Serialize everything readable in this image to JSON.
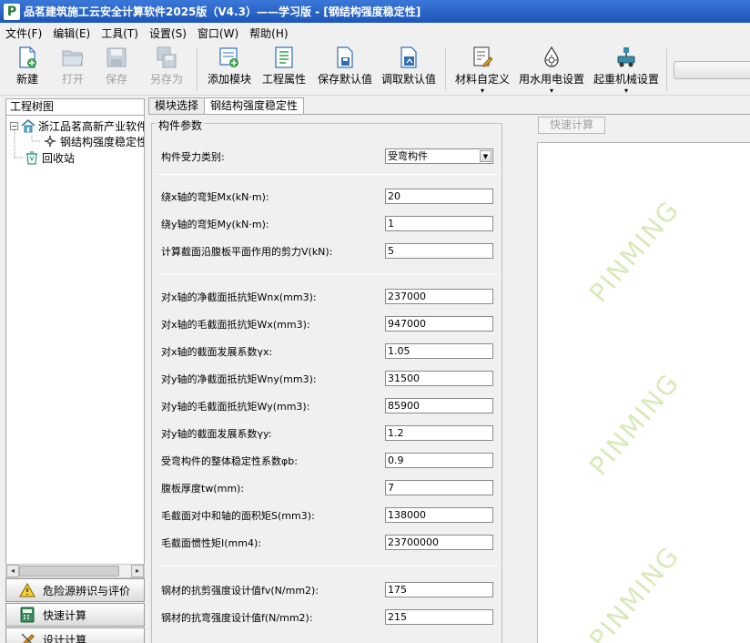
{
  "window": {
    "app_logo": "P",
    "title": "品茗建筑施工云安全计算软件2025版（V4.3）——学习版 - [钢结构强度稳定性]"
  },
  "menu": [
    "文件(F)",
    "编辑(E)",
    "工具(T)",
    "设置(S)",
    "窗口(W)",
    "帮助(H)"
  ],
  "toolbar": {
    "new": "新建",
    "open": "打开",
    "save": "保存",
    "save_as": "另存为",
    "add_module": "添加模块",
    "project_props": "工程属性",
    "save_default": "保存默认值",
    "load_default": "调取默认值",
    "material_custom": "材料自定义",
    "water_power": "用水用电设置",
    "crane": "起重机械设置",
    "caret": "▾"
  },
  "left": {
    "header": "工程树图",
    "tree": {
      "collapse_mark": "−",
      "project": "浙江品茗高新产业软件",
      "module": "钢结构强度稳定性",
      "recycle": "回收站"
    },
    "scroll_left": "◂",
    "scroll_right": "▸",
    "nav": [
      "危险源辨识与评价",
      "快速计算",
      "设计计算"
    ]
  },
  "tabs": [
    "模块选择",
    "钢结构强度稳定性"
  ],
  "form": {
    "group_title": "构件参数",
    "select_label": "构件受力类别:",
    "select_value": "受弯构件",
    "select_arrow": "▼",
    "fields": [
      {
        "label": "绕x轴的弯矩Mx(kN·m):",
        "value": "20"
      },
      {
        "label": "绕y轴的弯矩My(kN·m):",
        "value": "1"
      },
      {
        "label": "计算截面沿腹板平面作用的剪力V(kN):",
        "value": "5"
      },
      {
        "label": "对x轴的净截面抵抗矩Wnx(mm3):",
        "value": "237000"
      },
      {
        "label": "对x轴的毛截面抵抗矩Wx(mm3):",
        "value": "947000"
      },
      {
        "label": "对x轴的截面发展系数γx:",
        "value": "1.05"
      },
      {
        "label": "对y轴的净截面抵抗矩Wny(mm3):",
        "value": "31500"
      },
      {
        "label": "对y轴的毛截面抵抗矩Wy(mm3):",
        "value": "85900"
      },
      {
        "label": "对y轴的截面发展系数γy:",
        "value": "1.2"
      },
      {
        "label": "受弯构件的整体稳定性系数φb:",
        "value": "0.9"
      },
      {
        "label": "腹板厚度tw(mm):",
        "value": "7"
      },
      {
        "label": "毛截面对中和轴的面积矩S(mm3):",
        "value": "138000"
      },
      {
        "label": "毛截面惯性矩I(mm4):",
        "value": "23700000"
      },
      {
        "label": "钢材的抗剪强度设计值fv(N/mm2):",
        "value": "175"
      },
      {
        "label": "钢材的抗弯强度设计值f(N/mm2):",
        "value": "215"
      }
    ]
  },
  "result": {
    "calc_button": "快速计算",
    "watermark": "PINMING"
  }
}
